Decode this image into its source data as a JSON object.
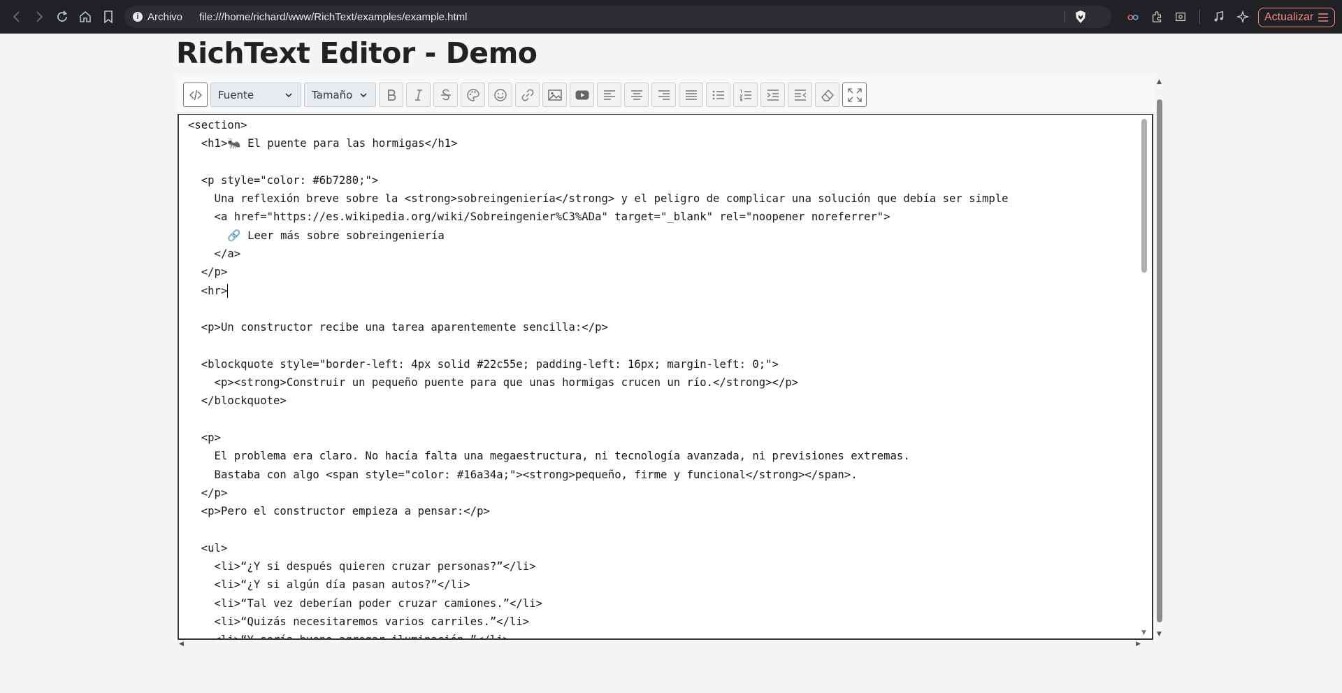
{
  "browser": {
    "site_label": "Archivo",
    "url": "file:///home/richard/www/RichText/examples/example.html",
    "update_label": "Actualizar"
  },
  "page": {
    "title": "RichText Editor - Demo"
  },
  "toolbar": {
    "font_select": "Fuente",
    "size_select": "Tamaño",
    "buttons": [
      "source-code",
      "bold",
      "italic",
      "strikethrough",
      "color",
      "emoji",
      "link",
      "image",
      "video",
      "align-left",
      "align-center",
      "align-right",
      "align-justify",
      "bullet-list",
      "numbered-list",
      "indent",
      "outdent",
      "clear-format",
      "fullscreen"
    ]
  },
  "editor": {
    "lines": [
      "<section>",
      "  <h1>🐜 El puente para las hormigas</h1>",
      "",
      "  <p style=\"color: #6b7280;\">",
      "    Una reflexión breve sobre la <strong>sobreingeniería</strong> y el peligro de complicar una solución que debía ser simple",
      "    <a href=\"https://es.wikipedia.org/wiki/Sobreingenier%C3%ADa\" target=\"_blank\" rel=\"noopener noreferrer\">",
      "      🔗 Leer más sobre sobreingeniería",
      "    </a>",
      "  </p>",
      "  <hr>",
      "",
      "  <p>Un constructor recibe una tarea aparentemente sencilla:</p>",
      "",
      "  <blockquote style=\"border-left: 4px solid #22c55e; padding-left: 16px; margin-left: 0;\">",
      "    <p><strong>Construir un pequeño puente para que unas hormigas crucen un río.</strong></p>",
      "  </blockquote>",
      "",
      "  <p>",
      "    El problema era claro. No hacía falta una megaestructura, ni tecnología avanzada, ni previsiones extremas.",
      "    Bastaba con algo <span style=\"color: #16a34a;\"><strong>pequeño, firme y funcional</strong></span>.",
      "  </p>",
      "  <p>Pero el constructor empieza a pensar:</p>",
      "",
      "  <ul>",
      "    <li>“¿Y si después quieren cruzar personas?”</li>",
      "    <li>“¿Y si algún día pasan autos?”</li>",
      "    <li>“Tal vez deberían poder cruzar camiones.”</li>",
      "    <li>“Quizás necesitaremos varios carriles.”</li>",
      "    <li>“Y sería bueno agregar iluminación.”</li>"
    ]
  }
}
